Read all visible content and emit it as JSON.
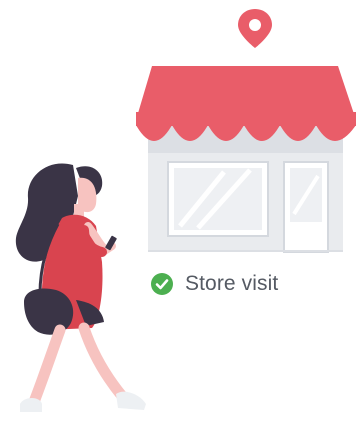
{
  "status": {
    "label": "Store visit",
    "state": "completed",
    "icon": "check-circle-icon",
    "icon_color": "#4caf50"
  },
  "illustration": {
    "pin_icon": "location-pin-icon",
    "colors": {
      "awning": "#e95d69",
      "store": "#e9ebee",
      "window": "#d4d8de",
      "pin": "#e95d69",
      "dress": "#d9444f",
      "hair": "#3a3446",
      "skin": "#f7c3c0"
    }
  }
}
